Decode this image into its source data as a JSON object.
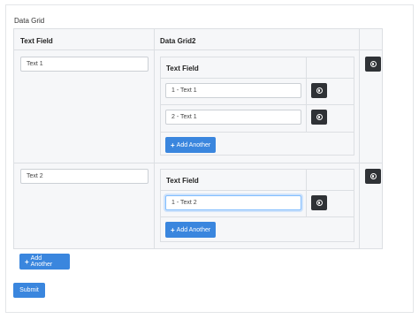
{
  "grid_title": "Data Grid",
  "headers": {
    "text_field": "Text Field",
    "data_grid2": "Data Grid2"
  },
  "rows": [
    {
      "text_field_value": "Text 1",
      "inner_header": "Text Field",
      "inner_rows": [
        "1 - Text 1",
        "2 - Text 1"
      ],
      "add_label": "Add Another"
    },
    {
      "text_field_value": "Text 2",
      "inner_header": "Text Field",
      "inner_rows": [
        "1 - Text 2"
      ],
      "add_label": "Add Another"
    }
  ],
  "add_another_label": "Add Another",
  "submit_label": "Submit",
  "colors": {
    "primary": "#3a86de",
    "remove": "#2f3236",
    "focus": "#80bdff"
  },
  "icons": {
    "remove": "remove-circle-icon",
    "add": "plus-icon"
  }
}
